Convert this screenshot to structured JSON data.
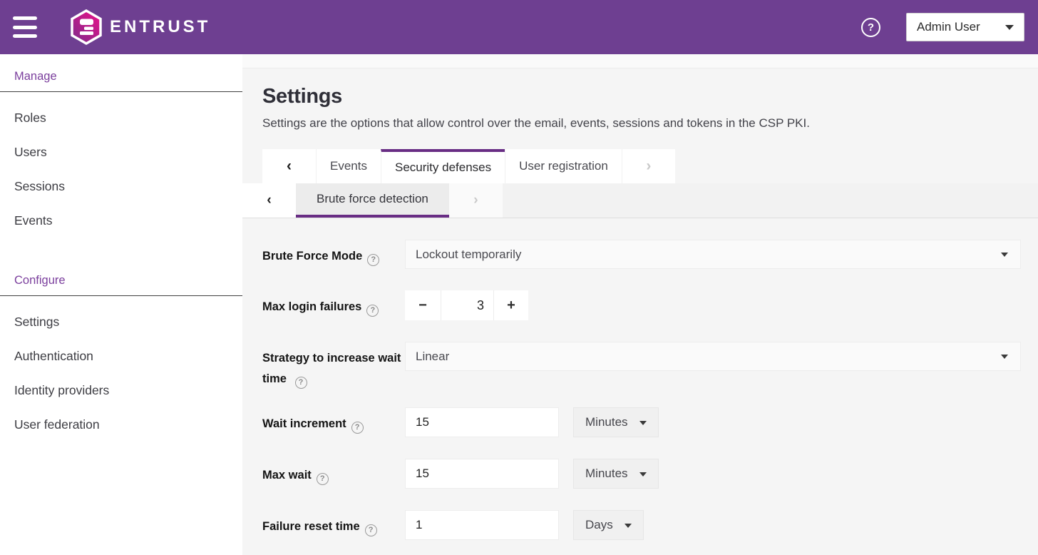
{
  "appearance": {
    "header_purple": "#6e3f91",
    "accent_purple": "#682d84",
    "brand_magenta": "#e8128a",
    "section_title_purple": "#7b3f9d",
    "page_background": "#f5f5f5"
  },
  "header": {
    "brand": "ENTRUST",
    "help_glyph": "?",
    "user_menu_label": "Admin User"
  },
  "sidebar": {
    "groups": [
      {
        "title": "Manage",
        "items": [
          "Roles",
          "Users",
          "Sessions",
          "Events"
        ]
      },
      {
        "title": "Configure",
        "items": [
          "Settings",
          "Authentication",
          "Identity providers",
          "User federation"
        ]
      }
    ]
  },
  "page": {
    "title": "Settings",
    "description": "Settings are the options that allow control over the email, events, sessions and tokens in the CSP PKI."
  },
  "tabs": {
    "scroll_left": "‹",
    "scroll_right": "›",
    "items": [
      "Events",
      "Security defenses",
      "User registration"
    ],
    "active": "Security defenses"
  },
  "subtabs": {
    "scroll_left": "‹",
    "scroll_right": "›",
    "items": [
      "Brute force detection"
    ],
    "active": "Brute force detection"
  },
  "icons": {
    "question": "?"
  },
  "form": {
    "brute_force_mode": {
      "label": "Brute Force Mode",
      "value": "Lockout temporarily"
    },
    "max_login_failures": {
      "label": "Max login failures",
      "value": "3",
      "decrement": "−",
      "increment": "+"
    },
    "wait_strategy": {
      "label": "Strategy to increase wait time",
      "value": "Linear"
    },
    "wait_increment": {
      "label": "Wait increment",
      "value": "15",
      "unit": "Minutes"
    },
    "max_wait": {
      "label": "Max wait",
      "value": "15",
      "unit": "Minutes"
    },
    "failure_reset_time": {
      "label": "Failure reset time",
      "value": "1",
      "unit": "Days"
    }
  }
}
